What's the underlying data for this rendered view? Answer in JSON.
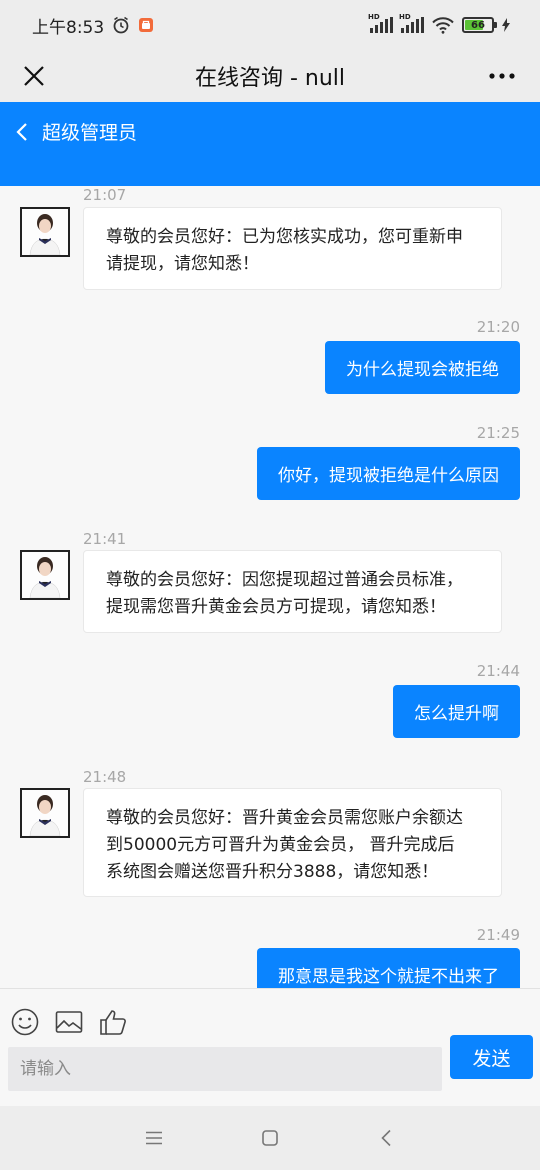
{
  "status": {
    "time": "上午8:53",
    "battery": "66",
    "hd1": "HD",
    "hd2": "HD"
  },
  "title_bar": {
    "title": "在线咨询 - null"
  },
  "header": {
    "agent_name": "超级管理员"
  },
  "messages": [
    {
      "time": "21:07",
      "text_lines": [
        "尊敬的会员您好：已为您核实成功，您可重新申",
        "请提现，请您知悉！"
      ]
    },
    {
      "time": "21:20",
      "text": "为什么提现会被拒绝"
    },
    {
      "time": "21:25",
      "text": "你好，提现被拒绝是什么原因"
    },
    {
      "time": "21:41",
      "text_lines": [
        "尊敬的会员您好：因您提现超过普通会员标准，",
        "提现需您晋升黄金会员方可提现，请您知悉！"
      ]
    },
    {
      "time": "21:44",
      "text": "怎么提升啊"
    },
    {
      "time": "21:48",
      "text_lines": [
        "尊敬的会员您好：晋升黄金会员需您账户余额达",
        "到50000元方可晋升为黄金会员， 晋升完成后",
        "系统图会赠送您晋升积分3888，请您知悉！"
      ]
    },
    {
      "time": "21:49",
      "text": "那意思是我这个就提不出来了"
    }
  ],
  "input": {
    "placeholder": "请输入",
    "send_label": "发送"
  },
  "colors": {
    "accent": "#0a84ff",
    "background": "#f7f7f7"
  }
}
